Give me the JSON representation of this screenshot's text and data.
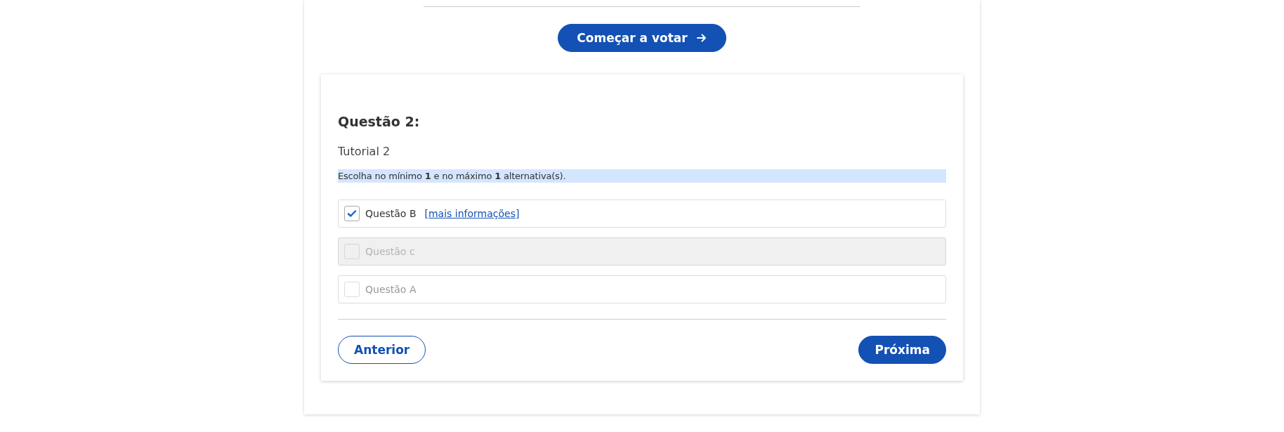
{
  "start_button": {
    "label": "Começar a votar"
  },
  "question": {
    "title": "Questão 2:",
    "subtitle": "Tutorial 2",
    "instruction": "Escolha no mínimo **1** e no máximo **1** alternativa(s).",
    "options": [
      {
        "label": "Questão B",
        "link": "[mais informações]",
        "checked": true,
        "disabled": false
      },
      {
        "label": "Questão c",
        "checked": false,
        "disabled": true
      },
      {
        "label": "Questão A",
        "checked": false,
        "disabled": false
      }
    ]
  },
  "buttons": {
    "previous": "Anterior",
    "next": "Próxima"
  }
}
